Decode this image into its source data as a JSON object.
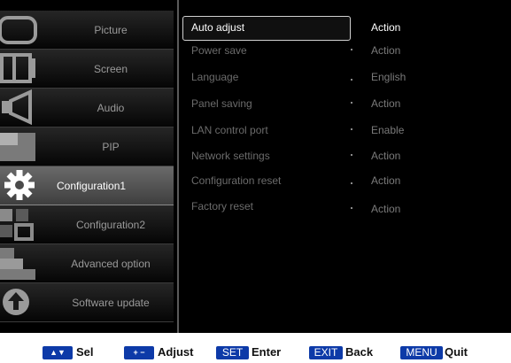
{
  "nav": {
    "items": [
      {
        "label": "Picture",
        "icon": "picture-icon",
        "active": false
      },
      {
        "label": "Screen",
        "icon": "screen-icon",
        "active": false
      },
      {
        "label": "Audio",
        "icon": "audio-icon",
        "active": false
      },
      {
        "label": "PIP",
        "icon": "pip-icon",
        "active": false
      },
      {
        "label": "Configuration1",
        "icon": "gear-icon",
        "active": true
      },
      {
        "label": "Configuration2",
        "icon": "configuration2-icon",
        "active": false
      },
      {
        "label": "Advanced option",
        "icon": "advanced-option-icon",
        "active": false
      },
      {
        "label": "Software update",
        "icon": "software-update-icon",
        "active": false
      }
    ]
  },
  "settings": {
    "rows": [
      {
        "name": "Auto adjust",
        "value": "Action",
        "selected": true
      },
      {
        "name": "Power save",
        "value": "Action",
        "selected": false
      },
      {
        "name": "Language",
        "value": "English",
        "selected": false
      },
      {
        "name": "Panel saving",
        "value": "Action",
        "selected": false
      },
      {
        "name": "LAN control port",
        "value": "Enable",
        "selected": false
      },
      {
        "name": "Network settings",
        "value": "Action",
        "selected": false
      },
      {
        "name": "Configuration reset",
        "value": "Action",
        "selected": false
      },
      {
        "name": "Factory reset",
        "value": "Action",
        "selected": false
      }
    ]
  },
  "legend": {
    "sel_key": "▲▼",
    "sel_label": "Sel",
    "adjust_key": "+ −",
    "adjust_label": "Adjust",
    "enter_key": "SET",
    "enter_label": "Enter",
    "back_key": "EXIT",
    "back_label": "Back",
    "quit_key": "MENU",
    "quit_label": "Quit"
  },
  "colors": {
    "osd_background": "#000000",
    "active_nav": "#5a5a5a",
    "legend_key": "#0d3aa8"
  }
}
